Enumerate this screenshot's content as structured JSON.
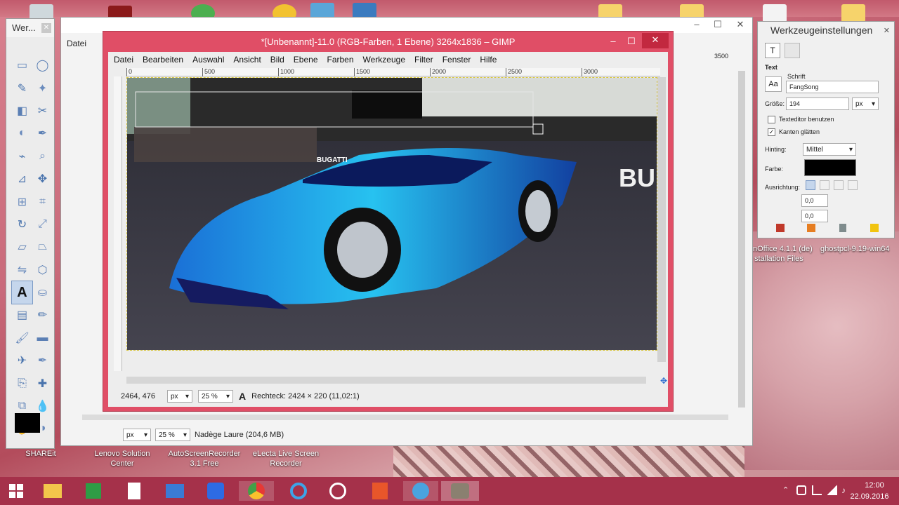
{
  "desktop": {
    "icons": [
      {
        "label": "SHAREit"
      },
      {
        "label": "Lenovo Solution Center"
      },
      {
        "label": "AutoScreenRecorder 3.1 Free"
      },
      {
        "label": "eLecta Live Screen Recorder"
      }
    ],
    "right_text": [
      "nOffice 4.1.1 (de)",
      "stallation Files",
      "ghostpcl-9.19-win64"
    ]
  },
  "toolbox": {
    "title": "Wer...",
    "tools": [
      "rect-select-icon",
      "ellipse-select-icon",
      "lasso-icon",
      "magic-wand-icon",
      "color-select-icon",
      "scissors-icon",
      "foreground-select-icon",
      "paths-icon",
      "color-picker-icon",
      "zoom-icon",
      "measure-icon",
      "move-icon",
      "align-icon",
      "crop-icon",
      "rotate-icon",
      "scale-icon",
      "shear-icon",
      "perspective-icon",
      "flip-icon",
      "cage-icon",
      "text-icon",
      "bucket-fill-icon",
      "blend-icon",
      "pencil-icon",
      "paintbrush-icon",
      "eraser-icon",
      "airbrush-icon",
      "ink-icon",
      "clone-icon",
      "heal-icon",
      "perspective-clone-icon",
      "blur-icon",
      "smudge-icon",
      "dodge-burn-icon"
    ],
    "active_tool": "text-icon"
  },
  "bg_window": {
    "menu_first": "Datei",
    "ruler_right": "3500",
    "status_unit": "px",
    "status_zoom": "25 %",
    "status_text": "Nadège Laure (204,6 MB)"
  },
  "main_window": {
    "title": "*[Unbenannt]-11.0 (RGB-Farben, 1 Ebene) 3264x1836 – GIMP",
    "menu": [
      "Datei",
      "Bearbeiten",
      "Auswahl",
      "Ansicht",
      "Bild",
      "Ebene",
      "Farben",
      "Werkzeuge",
      "Filter",
      "Fenster",
      "Hilfe"
    ],
    "ruler_ticks": [
      {
        "label": "0"
      },
      {
        "label": "500"
      },
      {
        "label": "1000"
      },
      {
        "label": "1500"
      },
      {
        "label": "2000"
      },
      {
        "label": "2500"
      },
      {
        "label": "3000"
      }
    ],
    "canvas_text": "BU",
    "car_badge": "BUGATTI",
    "status": {
      "coords": "2464, 476",
      "unit": "px",
      "zoom": "25 %",
      "message": "Rechteck: 2424 × 220  (11,02:1)"
    }
  },
  "tool_options": {
    "title": "Werkzeugeinstellungen",
    "section": "Text",
    "font_label": "Schrift",
    "font_value": "FangSong",
    "size_label": "Größe:",
    "size_value": "194",
    "size_unit": "px",
    "editor_label": "Texteditor benutzen",
    "editor_checked": false,
    "antialias_label": "Kanten glätten",
    "antialias_checked": true,
    "hinting_label": "Hinting:",
    "hinting_value": "Mittel",
    "color_label": "Farbe:",
    "color_value": "#000000",
    "align_label": "Ausrichtung:",
    "indent_value": "0,0",
    "spacing_value": "0,0"
  },
  "taskbar": {
    "time": "12:00",
    "date": "22.09.2016"
  }
}
